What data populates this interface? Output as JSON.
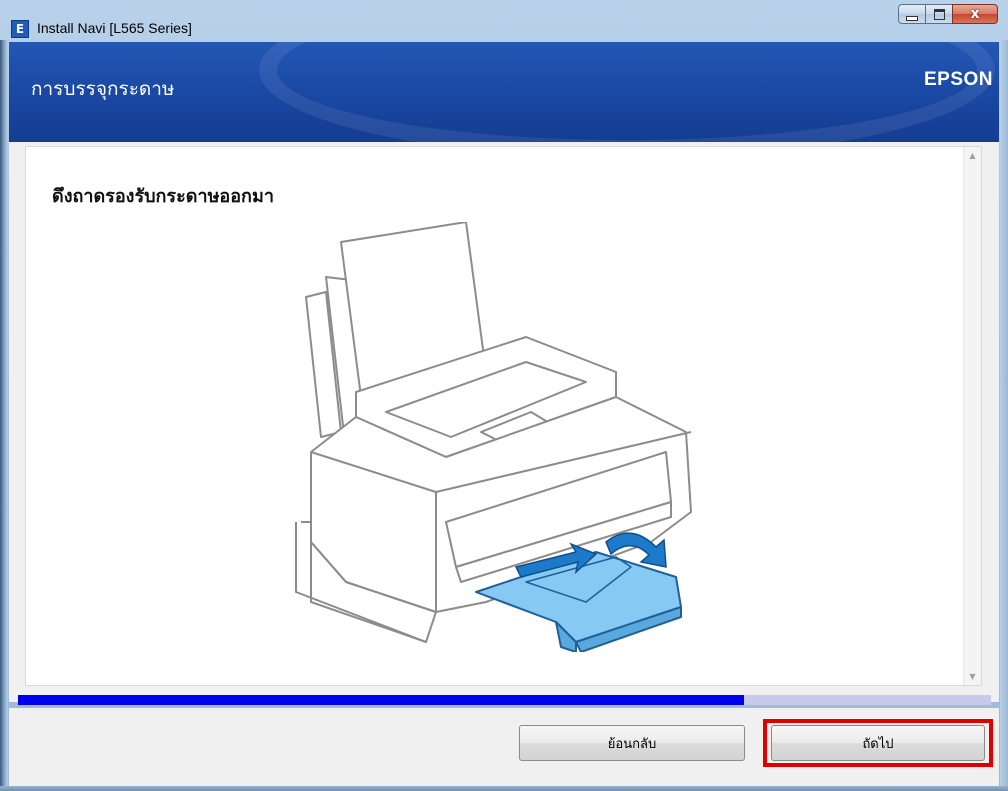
{
  "window": {
    "title": "Install Navi [L565 Series]",
    "icon_letter": "E",
    "controls": {
      "minimize": "minimize",
      "maximize": "maximize",
      "close": "x"
    }
  },
  "banner": {
    "title": "การบรรจุกระดาษ",
    "brand": "EPSON"
  },
  "content": {
    "heading": "ดึงถาดรองรับกระดาษออกมา",
    "illustration": "printer-output-tray-pull-out"
  },
  "progress": {
    "fraction": 0.746
  },
  "footer": {
    "back_label": "ย้อนกลับ",
    "next_label": "ถัดไป"
  },
  "colors": {
    "banner_blue": "#1b4aa6",
    "progress_fill": "#0000ee",
    "progress_track": "#c9c9ee",
    "highlight_red": "#e00000",
    "tray_blue": "#7fc4ef"
  }
}
